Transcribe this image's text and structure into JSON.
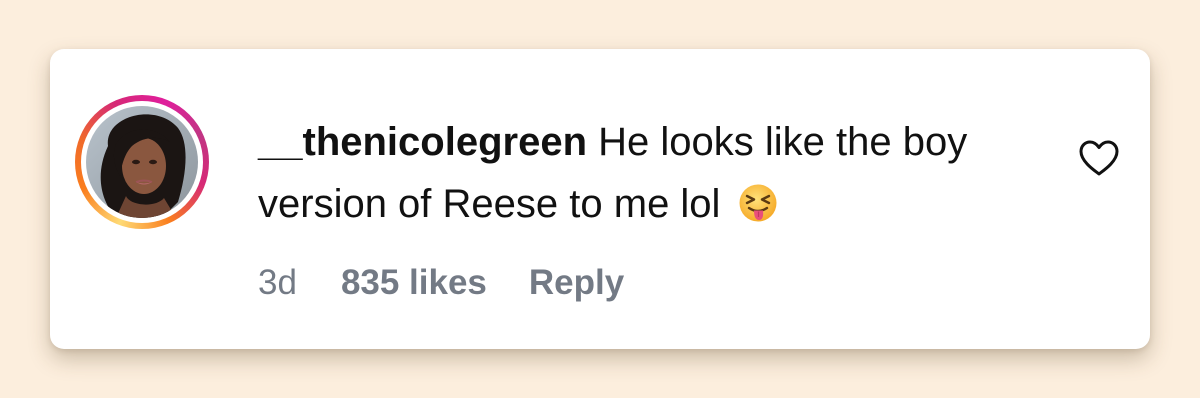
{
  "comment": {
    "username": "__thenicolegreen",
    "text": "He looks like the boy version of Reese to me lol",
    "emoji": "squinting-tongue-face"
  },
  "meta": {
    "time": "3d",
    "likes": "835 likes",
    "reply_label": "Reply"
  },
  "icons": {
    "like": "heart-outline-icon"
  },
  "colors": {
    "page_background": "#fceedd",
    "card_background": "#ffffff",
    "text": "#111111",
    "meta_text": "#737a85",
    "story_ring": [
      "#feda75",
      "#fa7e1e",
      "#d62976",
      "#c13584"
    ]
  }
}
